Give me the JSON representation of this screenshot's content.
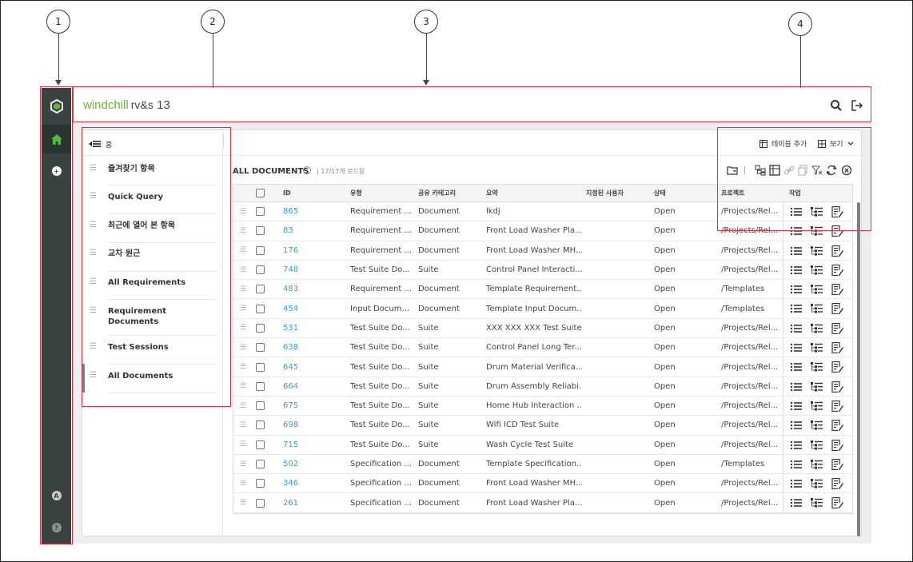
{
  "callouts": [
    "1",
    "2",
    "3",
    "4"
  ],
  "app": {
    "brand_name": "windchill",
    "brand_product": "rv&s",
    "brand_version": "13"
  },
  "rail": {
    "user_initial": "A",
    "help_glyph": "?"
  },
  "sidebar": {
    "home_label": "홈",
    "items": [
      {
        "label": "즐겨찾기 항목"
      },
      {
        "label": "Quick Query"
      },
      {
        "label": "최근에 열어 본 항목"
      },
      {
        "label": "교차 원근"
      },
      {
        "label": "All Requirements"
      },
      {
        "label": "Requirement Documents"
      },
      {
        "label": "Test Sessions"
      },
      {
        "label": "All Documents"
      }
    ]
  },
  "toolbar": {
    "add_table_label": "테이블 추가",
    "view_label": "보기"
  },
  "documents": {
    "title": "ALL DOCUMENTS",
    "count": "17/17개 로드됨",
    "columns": [
      "ID",
      "유형",
      "공유 카테고리",
      "요약",
      "지정된 사용자",
      "상태",
      "프로젝트",
      "작업"
    ],
    "rows": [
      {
        "id": "865",
        "type": "Requirement ...",
        "category": "Document",
        "summary": "lkdj",
        "assigned": "",
        "state": "Open",
        "project": "/Projects/Rel..."
      },
      {
        "id": "83",
        "type": "Requirement ...",
        "category": "Document",
        "summary": "Front Load Washer Pla...",
        "assigned": "",
        "state": "Open",
        "project": "/Projects/Rel..."
      },
      {
        "id": "176",
        "type": "Requirement ...",
        "category": "Document",
        "summary": "Front Load Washer MH...",
        "assigned": "",
        "state": "Open",
        "project": "/Projects/Rel..."
      },
      {
        "id": "748",
        "type": "Test Suite Do...",
        "category": "Suite",
        "summary": "Control Panel Interacti...",
        "assigned": "",
        "state": "Open",
        "project": "/Projects/Rel..."
      },
      {
        "id": "483",
        "type": "Requirement ...",
        "category": "Document",
        "summary": "Template Requirement...",
        "assigned": "",
        "state": "Open",
        "project": "/Templates"
      },
      {
        "id": "454",
        "type": "Input Docum...",
        "category": "Document",
        "summary": "Template Input Docum...",
        "assigned": "",
        "state": "Open",
        "project": "/Templates"
      },
      {
        "id": "531",
        "type": "Test Suite Do...",
        "category": "Suite",
        "summary": "XXX XXX XXX Test Suite",
        "assigned": "",
        "state": "Open",
        "project": "/Projects/Rel..."
      },
      {
        "id": "638",
        "type": "Test Suite Do...",
        "category": "Suite",
        "summary": "Control Panel Long Ter...",
        "assigned": "",
        "state": "Open",
        "project": "/Projects/Rel..."
      },
      {
        "id": "645",
        "type": "Test Suite Do...",
        "category": "Suite",
        "summary": "Drum Material Verifica...",
        "assigned": "",
        "state": "Open",
        "project": "/Projects/Rel..."
      },
      {
        "id": "664",
        "type": "Test Suite Do...",
        "category": "Suite",
        "summary": "Drum Assembly Reliabi...",
        "assigned": "",
        "state": "Open",
        "project": "/Projects/Rel..."
      },
      {
        "id": "675",
        "type": "Test Suite Do...",
        "category": "Suite",
        "summary": "Home Hub Interaction ...",
        "assigned": "",
        "state": "Open",
        "project": "/Projects/Rel..."
      },
      {
        "id": "698",
        "type": "Test Suite Do...",
        "category": "Suite",
        "summary": "Wifi ICD Test Suite",
        "assigned": "",
        "state": "Open",
        "project": "/Projects/Rel..."
      },
      {
        "id": "715",
        "type": "Test Suite Do...",
        "category": "Suite",
        "summary": "Wash Cycle Test Suite",
        "assigned": "",
        "state": "Open",
        "project": "/Projects/Rel..."
      },
      {
        "id": "502",
        "type": "Specification ...",
        "category": "Document",
        "summary": "Template Specification...",
        "assigned": "",
        "state": "Open",
        "project": "/Templates"
      },
      {
        "id": "346",
        "type": "Specification ...",
        "category": "Document",
        "summary": "Front Load Washer MH...",
        "assigned": "",
        "state": "Open",
        "project": "/Projects/Rel..."
      },
      {
        "id": "261",
        "type": "Specification ...",
        "category": "Document",
        "summary": "Front Load Washer Pla...",
        "assigned": "",
        "state": "Open",
        "project": "/Projects/Rel..."
      }
    ]
  },
  "colors": {
    "rail_bg": "#3a4342",
    "accent_green": "#6cb33f",
    "link_blue": "#3a9bd5",
    "callout_red": "#e0323c"
  }
}
